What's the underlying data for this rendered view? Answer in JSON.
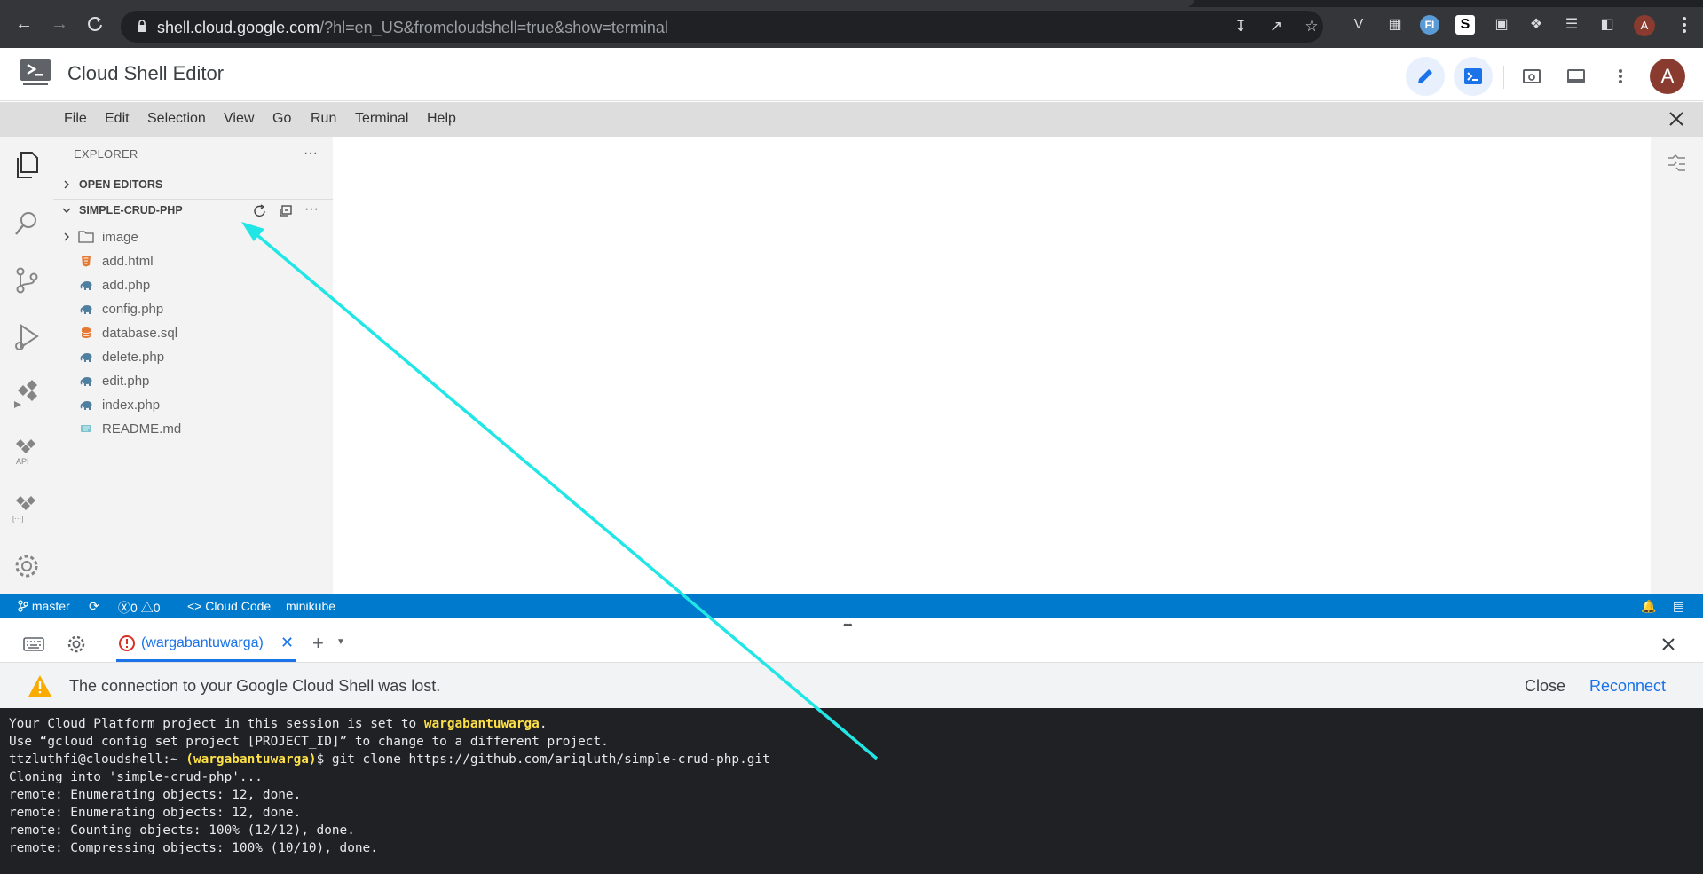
{
  "browser": {
    "url_host": "shell.cloud.google.com",
    "url_path": "/?hl=en_US&fromcloudshell=true&show=terminal",
    "profile_initial": "A",
    "extension_badge": "FI"
  },
  "app": {
    "title": "Cloud Shell Editor",
    "avatar_initial": "A"
  },
  "menu": [
    "File",
    "Edit",
    "Selection",
    "View",
    "Go",
    "Run",
    "Terminal",
    "Help"
  ],
  "explorer": {
    "header": "EXPLORER",
    "open_editors": "OPEN EDITORS",
    "project": "SIMPLE-CRUD-PHP",
    "folder": "image",
    "files": [
      {
        "name": "add.html",
        "type": "html"
      },
      {
        "name": "add.php",
        "type": "php"
      },
      {
        "name": "config.php",
        "type": "php"
      },
      {
        "name": "database.sql",
        "type": "sql"
      },
      {
        "name": "delete.php",
        "type": "php"
      },
      {
        "name": "edit.php",
        "type": "php"
      },
      {
        "name": "index.php",
        "type": "php"
      },
      {
        "name": "README.md",
        "type": "md"
      }
    ]
  },
  "activity": {
    "api_label": "API",
    "secret_label": "[···]"
  },
  "status": {
    "branch": "master",
    "errors": "0",
    "warnings": "0",
    "cloud_code": "Cloud Code",
    "cluster": "minikube"
  },
  "terminal": {
    "tab_label": "(wargabantuwarga)",
    "banner_message": "The connection to your Google Cloud Shell was lost.",
    "close_label": "Close",
    "reconnect_label": "Reconnect",
    "lines": {
      "l1_pre": "Your Cloud Platform project in this session is set to ",
      "l1_proj": "wargabantuwarga",
      "l1_post": ".",
      "l2": "Use “gcloud config set project [PROJECT_ID]” to change to a different project.",
      "l3_prompt": "ttzluthfi@cloudshell:~ ",
      "l3_proj": "(wargabantuwarga)",
      "l3_cmd": "$ git clone https://github.com/ariqluth/simple-crud-php.git",
      "l4": "Cloning into 'simple-crud-php'...",
      "l5": "remote: Enumerating objects: 12, done.",
      "l6": "remote: Enumerating objects: 12, done.",
      "l7": "remote: Counting objects: 100% (12/12), done.",
      "l8": "remote: Compressing objects: 100% (10/10), done."
    }
  },
  "colors": {
    "status_bar": "#007acc",
    "annotation_arrow": "#22e6e6",
    "terminal_highlight": "#fde047",
    "link_blue": "#1a73e8"
  }
}
